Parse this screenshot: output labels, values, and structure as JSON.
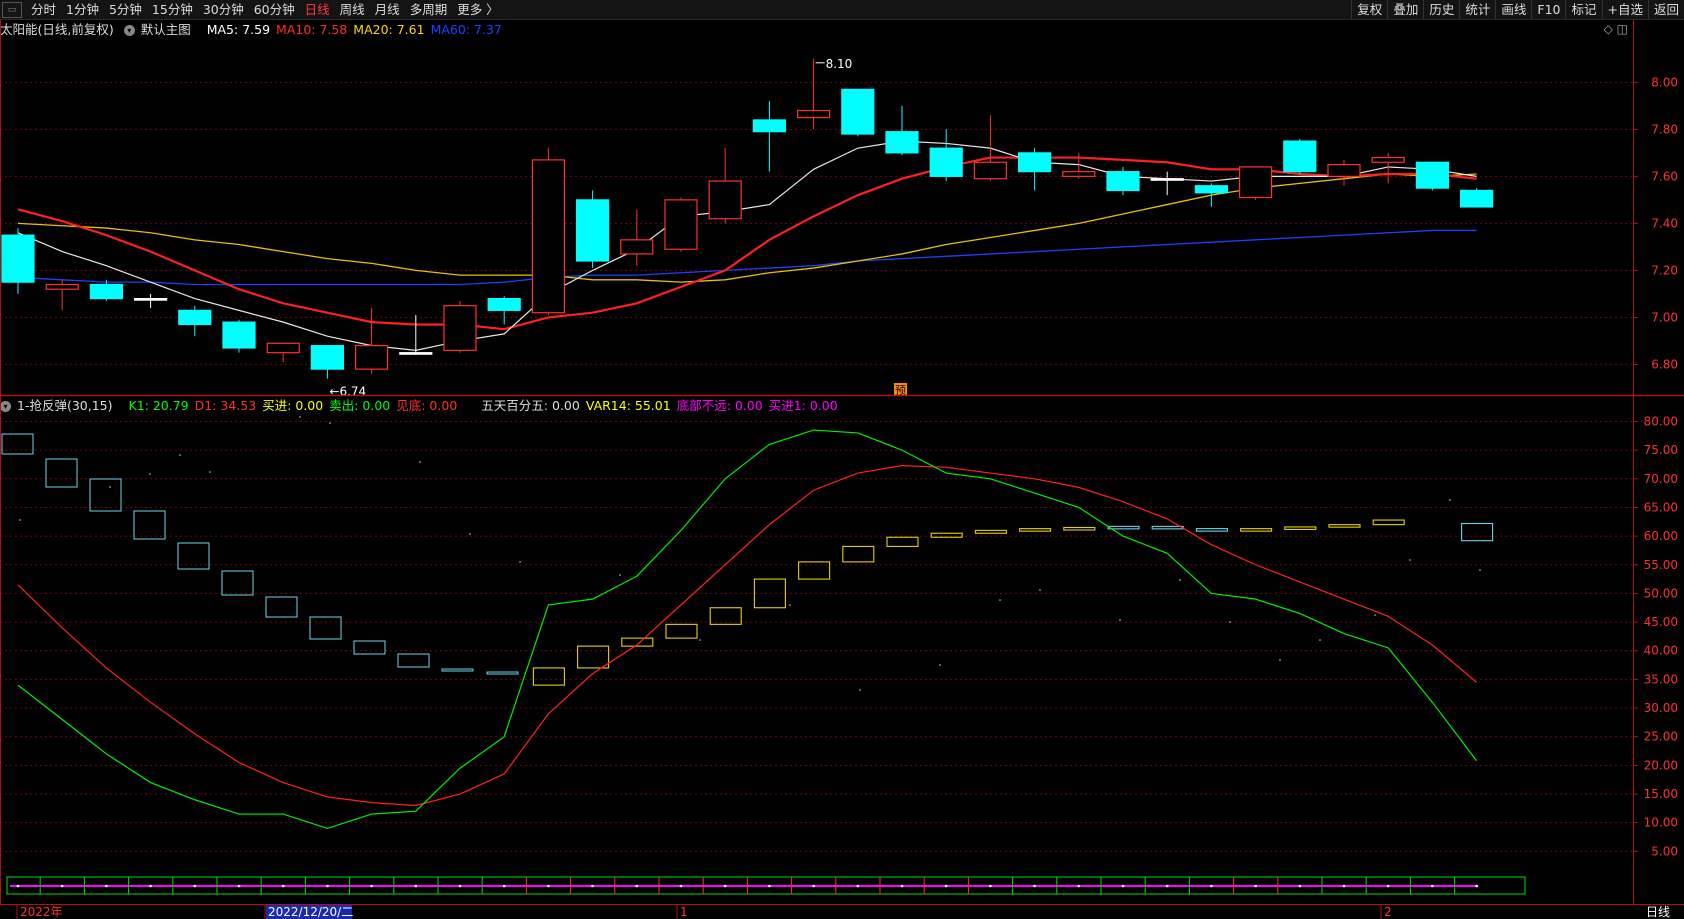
{
  "toolbar": {
    "periods": [
      "分时",
      "1分钟",
      "5分钟",
      "15分钟",
      "30分钟",
      "60分钟",
      "日线",
      "周线",
      "月线",
      "多周期",
      "更多 〉"
    ],
    "active_period": "日线",
    "right_buttons": [
      "复权",
      "叠加",
      "历史",
      "统计",
      "画线",
      "F10",
      "标记",
      "+自选",
      "返回"
    ]
  },
  "main": {
    "stock_name": "太阳能(日线,前复权)",
    "template": "默认主图",
    "ma": [
      {
        "label": "MA5: 7.59",
        "color": "#ffffff"
      },
      {
        "label": "MA10: 7.58",
        "color": "#ff2a2a"
      },
      {
        "label": "MA20: 7.61",
        "color": "#ffd700"
      },
      {
        "label": "MA60: 7.37",
        "color": "#1e40ff"
      }
    ],
    "high_label": "8.10",
    "low_label": "6.74",
    "forecast_badge": "预",
    "y_ticks": [
      "8.00",
      "7.80",
      "7.60",
      "7.40",
      "7.20",
      "7.00",
      "6.80"
    ]
  },
  "indicator": {
    "name": "1-抢反弹(30,15)",
    "values": [
      {
        "label": "K1: 20.79",
        "color": "#00ff00"
      },
      {
        "label": "D1: 34.53",
        "color": "#ff3030"
      },
      {
        "label": "买进: 0.00",
        "color": "#ffff00"
      },
      {
        "label": "卖出: 0.00",
        "color": "#00ff00"
      },
      {
        "label": "见底: 0.00",
        "color": "#ff3030"
      },
      {
        "label": "五天百分五: 0.00",
        "color": "#dddddd"
      },
      {
        "label": "VAR14: 55.01",
        "color": "#ffff00"
      },
      {
        "label": "底部不远: 0.00",
        "color": "#ff00ff"
      },
      {
        "label": "买进1: 0.00",
        "color": "#ff00ff"
      }
    ],
    "y_ticks": [
      "80.00",
      "75.00",
      "70.00",
      "65.00",
      "60.00",
      "55.00",
      "50.00",
      "45.00",
      "40.00",
      "35.00",
      "30.00",
      "25.00",
      "20.00",
      "15.00",
      "10.00",
      "5.00"
    ]
  },
  "time_axis": {
    "labels": [
      "2022年",
      "2022/12/20/二",
      "1",
      "2"
    ],
    "period": "日线"
  },
  "corner_icons": "◇ ◫",
  "chart_data": [
    {
      "type": "candlestick",
      "ylim": [
        6.67,
        8.18
      ],
      "candles": [
        {
          "o": 7.35,
          "h": 7.38,
          "l": 7.1,
          "c": 7.15
        },
        {
          "o": 7.12,
          "h": 7.16,
          "l": 7.03,
          "c": 7.14
        },
        {
          "o": 7.14,
          "h": 7.16,
          "l": 7.07,
          "c": 7.08
        },
        {
          "o": 7.08,
          "h": 7.1,
          "l": 7.04,
          "c": 7.08
        },
        {
          "o": 7.03,
          "h": 7.05,
          "l": 6.92,
          "c": 6.97
        },
        {
          "o": 6.98,
          "h": 6.99,
          "l": 6.85,
          "c": 6.87
        },
        {
          "o": 6.85,
          "h": 6.89,
          "l": 6.81,
          "c": 6.89
        },
        {
          "o": 6.88,
          "h": 6.88,
          "l": 6.74,
          "c": 6.78
        },
        {
          "o": 6.78,
          "h": 7.04,
          "l": 6.76,
          "c": 6.88
        },
        {
          "o": 6.85,
          "h": 7.01,
          "l": 6.84,
          "c": 6.85
        },
        {
          "o": 6.86,
          "h": 7.07,
          "l": 6.85,
          "c": 7.05
        },
        {
          "o": 7.08,
          "h": 7.09,
          "l": 6.97,
          "c": 7.03
        },
        {
          "o": 7.02,
          "h": 7.72,
          "l": 7.01,
          "c": 7.67
        },
        {
          "o": 7.5,
          "h": 7.54,
          "l": 7.21,
          "c": 7.24
        },
        {
          "o": 7.27,
          "h": 7.46,
          "l": 7.22,
          "c": 7.33
        },
        {
          "o": 7.29,
          "h": 7.51,
          "l": 7.28,
          "c": 7.5
        },
        {
          "o": 7.42,
          "h": 7.72,
          "l": 7.4,
          "c": 7.58
        },
        {
          "o": 7.84,
          "h": 7.92,
          "l": 7.62,
          "c": 7.79
        },
        {
          "o": 7.85,
          "h": 8.1,
          "l": 7.8,
          "c": 7.88
        },
        {
          "o": 7.97,
          "h": 7.97,
          "l": 7.77,
          "c": 7.78
        },
        {
          "o": 7.79,
          "h": 7.9,
          "l": 7.69,
          "c": 7.7
        },
        {
          "o": 7.72,
          "h": 7.8,
          "l": 7.58,
          "c": 7.6
        },
        {
          "o": 7.59,
          "h": 7.86,
          "l": 7.58,
          "c": 7.66
        },
        {
          "o": 7.7,
          "h": 7.72,
          "l": 7.54,
          "c": 7.62
        },
        {
          "o": 7.6,
          "h": 7.7,
          "l": 7.59,
          "c": 7.62
        },
        {
          "o": 7.62,
          "h": 7.64,
          "l": 7.52,
          "c": 7.54
        },
        {
          "o": 7.59,
          "h": 7.62,
          "l": 7.52,
          "c": 7.59
        },
        {
          "o": 7.56,
          "h": 7.57,
          "l": 7.47,
          "c": 7.53
        },
        {
          "o": 7.51,
          "h": 7.64,
          "l": 7.5,
          "c": 7.64
        },
        {
          "o": 7.75,
          "h": 7.76,
          "l": 7.61,
          "c": 7.62
        },
        {
          "o": 7.6,
          "h": 7.67,
          "l": 7.56,
          "c": 7.65
        },
        {
          "o": 7.66,
          "h": 7.7,
          "l": 7.57,
          "c": 7.68
        },
        {
          "o": 7.66,
          "h": 7.66,
          "l": 7.54,
          "c": 7.55
        },
        {
          "o": 7.54,
          "h": 7.55,
          "l": 7.47,
          "c": 7.47
        }
      ],
      "ma5": [
        7.36,
        7.28,
        7.22,
        7.15,
        7.08,
        7.03,
        6.98,
        6.92,
        6.88,
        6.86,
        6.9,
        6.93,
        7.1,
        7.2,
        7.29,
        7.43,
        7.45,
        7.48,
        7.63,
        7.72,
        7.75,
        7.74,
        7.72,
        7.66,
        7.65,
        7.6,
        7.59,
        7.58,
        7.6,
        7.6,
        7.6,
        7.64,
        7.63,
        7.6
      ],
      "ma10": [
        7.46,
        7.41,
        7.35,
        7.28,
        7.2,
        7.12,
        7.06,
        7.02,
        6.98,
        6.97,
        6.97,
        6.95,
        7.0,
        7.02,
        7.06,
        7.13,
        7.2,
        7.33,
        7.43,
        7.52,
        7.59,
        7.64,
        7.68,
        7.68,
        7.68,
        7.67,
        7.66,
        7.63,
        7.63,
        7.61,
        7.6,
        7.61,
        7.61,
        7.59
      ],
      "ma20": [
        7.4,
        7.39,
        7.38,
        7.36,
        7.33,
        7.31,
        7.28,
        7.25,
        7.23,
        7.2,
        7.18,
        7.18,
        7.18,
        7.16,
        7.16,
        7.15,
        7.16,
        7.19,
        7.21,
        7.24,
        7.27,
        7.31,
        7.34,
        7.37,
        7.4,
        7.44,
        7.48,
        7.52,
        7.55,
        7.57,
        7.59,
        7.61,
        7.6,
        7.61
      ],
      "ma60": [
        7.17,
        7.16,
        7.15,
        7.15,
        7.14,
        7.14,
        7.14,
        7.14,
        7.14,
        7.14,
        7.14,
        7.15,
        7.17,
        7.18,
        7.18,
        7.19,
        7.2,
        7.21,
        7.22,
        7.24,
        7.25,
        7.26,
        7.27,
        7.28,
        7.29,
        7.3,
        7.31,
        7.32,
        7.33,
        7.34,
        7.35,
        7.36,
        7.37,
        7.37
      ]
    },
    {
      "type": "line",
      "ylim": [
        0,
        82
      ],
      "series": [
        {
          "name": "K1",
          "color": "#00ff00",
          "values": [
            34,
            28,
            22,
            17,
            14,
            11.5,
            11.5,
            9,
            11.5,
            12,
            19.5,
            25,
            48,
            49,
            53,
            61,
            70,
            76,
            78.5,
            78,
            75,
            71,
            70,
            67.5,
            65,
            60,
            57,
            50,
            49,
            46.5,
            43,
            40.5,
            31,
            20.8
          ]
        },
        {
          "name": "D1",
          "color": "#ff3030",
          "values": [
            51.5,
            44,
            37,
            31,
            25.5,
            20.5,
            17,
            14.5,
            13.5,
            13,
            15,
            18.5,
            29,
            36,
            41,
            48,
            55,
            62,
            68,
            71,
            72.3,
            72,
            71,
            70,
            68.5,
            66,
            63,
            58.5,
            55,
            52,
            49,
            46,
            41,
            34.5
          ]
        },
        {
          "name": "VAR14",
          "color": "#ffff00",
          "values": [
            null,
            null,
            null,
            null,
            null,
            null,
            null,
            null,
            null,
            null,
            null,
            null,
            37,
            40.8,
            42.2,
            44.6,
            47.5,
            52.5,
            55.5,
            58.2,
            59.8,
            60.5,
            61,
            61.3,
            61.5,
            61.7,
            61.3,
            61,
            61.3,
            61.6,
            62,
            62.8,
            null,
            62.2
          ]
        }
      ]
    }
  ]
}
